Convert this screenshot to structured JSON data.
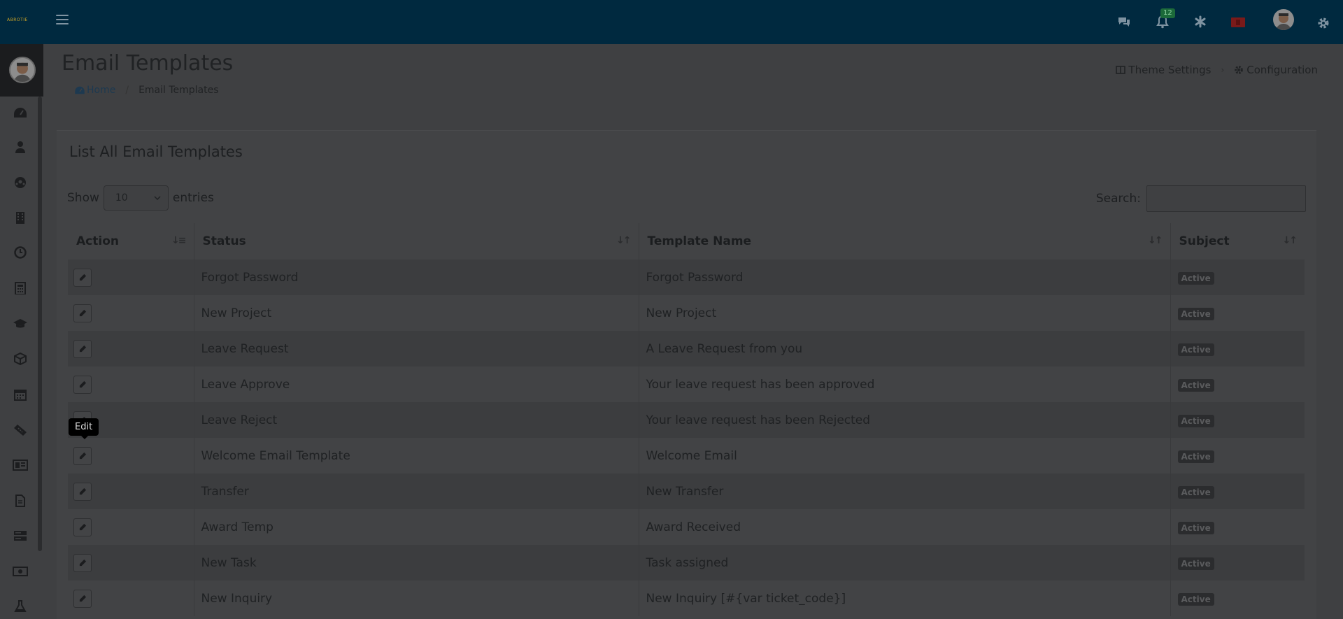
{
  "topbar": {
    "logo_text": "ABROTIE",
    "notification_count": "12"
  },
  "page": {
    "title": "Email Templates",
    "breadcrumb": {
      "home": "Home",
      "current": "Email Templates"
    },
    "links": {
      "theme_settings": "Theme Settings",
      "configuration": "Configuration"
    }
  },
  "card": {
    "title": "List All Email Templates",
    "show_label": "Show",
    "entries_value": "10",
    "entries_label": "entries",
    "search_label": "Search:",
    "columns": [
      "Action",
      "Status",
      "Template Name",
      "Subject"
    ]
  },
  "rows": [
    {
      "status": "Forgot Password",
      "template": "Forgot Password",
      "badge": "Active"
    },
    {
      "status": "New Project",
      "template": "New Project",
      "badge": "Active"
    },
    {
      "status": "Leave Request",
      "template": "A Leave Request from you",
      "badge": "Active"
    },
    {
      "status": "Leave Approve",
      "template": "Your leave request has been approved",
      "badge": "Active"
    },
    {
      "status": "Leave Reject",
      "template": "Your leave request has been Rejected",
      "badge": "Active"
    },
    {
      "status": "Welcome Email Template",
      "template": "Welcome Email",
      "badge": "Active"
    },
    {
      "status": "Transfer",
      "template": "New Transfer",
      "badge": "Active"
    },
    {
      "status": "Award Temp",
      "template": "Award Received",
      "badge": "Active"
    },
    {
      "status": "New Task",
      "template": "Task assigned",
      "badge": "Active"
    },
    {
      "status": "New Inquiry",
      "template": "New Inquiry [#{var ticket_code}]",
      "badge": "Active"
    }
  ],
  "tooltip": "Edit",
  "icons": {
    "top": [
      "chat-icon",
      "bell-icon",
      "asterisk-icon",
      "flag-icon",
      "avatar",
      "gear-icon"
    ],
    "sidebar": [
      "dashboard-icon",
      "user-icon",
      "soccer-icon",
      "building-icon",
      "clock-icon",
      "calculator-icon",
      "graduation-icon",
      "box-icon",
      "calendar-icon",
      "ticket-icon",
      "id-card-icon",
      "document-icon",
      "server-icon",
      "money-icon",
      "flask-icon"
    ]
  }
}
